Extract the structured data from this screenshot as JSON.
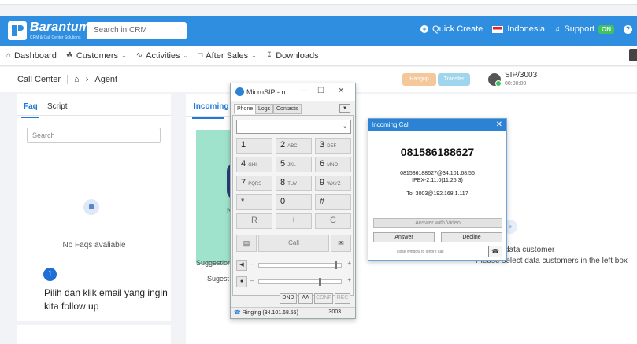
{
  "header": {
    "logo_text": "Barantum",
    "logo_sub": "CRM & Call Center Solutions",
    "search_placeholder": "Search in CRM",
    "quick_create": "Quick Create",
    "language": "Indonesia",
    "support": "Support",
    "support_badge": "ON",
    "help_glyph": "?"
  },
  "nav": {
    "items": [
      {
        "label": "Dashboard",
        "icon": "home-icon"
      },
      {
        "label": "Customers",
        "icon": "customers-icon"
      },
      {
        "label": "Activities",
        "icon": "activities-icon"
      },
      {
        "label": "After Sales",
        "icon": "after-sales-icon"
      },
      {
        "label": "Downloads",
        "icon": "downloads-icon"
      }
    ]
  },
  "breadcrumb": {
    "root": "Call Center",
    "current": "Agent"
  },
  "call_controls": {
    "hangup": "Hangup",
    "transfer": "Transfer",
    "sip_name": "SIP/3003",
    "sip_time": "00:00:00"
  },
  "faq": {
    "tab_faq": "Faq",
    "tab_script": "Script",
    "search_placeholder": "Search",
    "empty_text": "No Faqs avaliable"
  },
  "tutorial": {
    "step": "1",
    "text": "Pilih dan klik email yang ingin kita follow up"
  },
  "main": {
    "incoming_tab": "Incoming",
    "letter": "N",
    "suggestion_1": "Suggestion",
    "suggestion_2": "Sugest",
    "select_line_1": "data customer",
    "select_line_2": "Please select data customers in the left box"
  },
  "microsip": {
    "title": "MicroSIP - n...",
    "tabs": [
      "Phone",
      "Logs",
      "Contacts"
    ],
    "keys": [
      {
        "main": "1",
        "sub": ""
      },
      {
        "main": "2",
        "sub": "ABC"
      },
      {
        "main": "3",
        "sub": "DEF"
      },
      {
        "main": "4",
        "sub": "GHI"
      },
      {
        "main": "5",
        "sub": "JKL"
      },
      {
        "main": "6",
        "sub": "MNO"
      },
      {
        "main": "7",
        "sub": "PQRS"
      },
      {
        "main": "8",
        "sub": "TUV"
      },
      {
        "main": "9",
        "sub": "WXYZ"
      },
      {
        "main": "*",
        "sub": ""
      },
      {
        "main": "0",
        "sub": ""
      },
      {
        "main": "#",
        "sub": ""
      },
      {
        "main": "R",
        "sub": ""
      },
      {
        "main": "+",
        "sub": ""
      },
      {
        "main": "C",
        "sub": ""
      }
    ],
    "call_label": "Call",
    "buttons": [
      "DND",
      "AA",
      "CONF",
      "REC"
    ],
    "status": "Ringing (34.101.68.55)",
    "status_num": "3003"
  },
  "incoming_call": {
    "title": "Incoming Call",
    "number": "081586188627",
    "info_line_1": "081586188627@34.101.68.55",
    "info_line_2": "IPBX-2.11.0(11.25.3)",
    "to": "To: 3003@192.168.1.117",
    "answer_video": "Answer with Video",
    "answer": "Answer",
    "decline": "Decline",
    "note": "close window to ignore call"
  },
  "colors": {
    "header_blue": "#2f8ee0",
    "accent_blue": "#1f7ad6",
    "hangup": "#f4c89b",
    "transfer": "#9fd6ee",
    "status_green": "#3fc35f"
  }
}
